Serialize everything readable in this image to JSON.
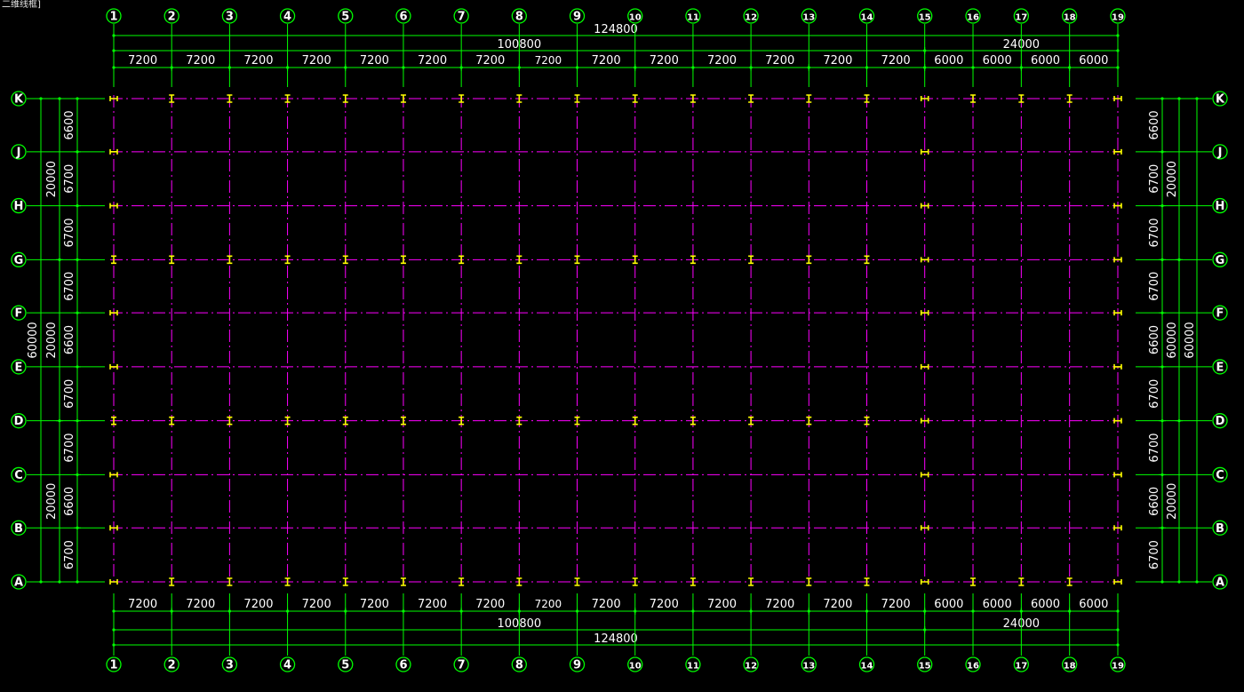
{
  "viewport": {
    "label": "二维线框]"
  },
  "colors": {
    "background": "#000000",
    "dimension": "#00ff00",
    "grid_line": "#ff00ff",
    "column": "#ffff00",
    "bubble": "#00ff00",
    "text": "#ffffff"
  },
  "grid": {
    "columns": [
      "1",
      "2",
      "3",
      "4",
      "5",
      "6",
      "7",
      "8",
      "9",
      "10",
      "11",
      "12",
      "13",
      "14",
      "15",
      "16",
      "17",
      "18",
      "19"
    ],
    "rows": [
      "A",
      "B",
      "C",
      "D",
      "E",
      "F",
      "G",
      "H",
      "J",
      "K"
    ],
    "col_spacing": [
      7200,
      7200,
      7200,
      7200,
      7200,
      7200,
      7200,
      7200,
      7200,
      7200,
      7200,
      7200,
      7200,
      7200,
      6000,
      6000,
      6000,
      6000
    ],
    "row_spacing": [
      6700,
      6600,
      6700,
      6700,
      6700,
      6600,
      6700,
      6700,
      6600,
      6700
    ]
  },
  "dimensions": {
    "top": {
      "overall": "124800",
      "segments": [
        {
          "label": "100800",
          "from": 0,
          "to": 14
        },
        {
          "label": "24000",
          "from": 14,
          "to": 18
        }
      ],
      "spans": [
        "7200",
        "7200",
        "7200",
        "7200",
        "7200",
        "7200",
        "7200",
        "7200",
        "7200",
        "7200",
        "7200",
        "7200",
        "7200",
        "7200",
        "6000",
        "6000",
        "6000",
        "6000"
      ]
    },
    "bottom": {
      "overall": "124800",
      "segments": [
        {
          "label": "100800",
          "from": 0,
          "to": 14
        },
        {
          "label": "24000",
          "from": 14,
          "to": 18
        }
      ],
      "spans": [
        "7200",
        "7200",
        "7200",
        "7200",
        "7200",
        "7200",
        "7200",
        "7200",
        "7200",
        "7200",
        "7200",
        "7200",
        "7200",
        "7200",
        "6000",
        "6000",
        "6000",
        "6000"
      ]
    },
    "left": {
      "overall": "60000",
      "segments": [
        {
          "label": "20000",
          "from": 0,
          "to": 3
        },
        {
          "label": "20000",
          "from": 3,
          "to": 6
        },
        {
          "label": "20000",
          "from": 6,
          "to": 9
        }
      ],
      "spans": [
        "6700",
        "6600",
        "6700",
        "6700",
        "6600",
        "6700",
        "6700",
        "6700",
        "6600",
        "6700"
      ]
    },
    "right": {
      "overall": "60000",
      "segments": [
        {
          "label": "20000",
          "from": 0,
          "to": 3
        },
        {
          "label": "60000",
          "from": 3,
          "to": 6
        },
        {
          "label": "20000",
          "from": 6,
          "to": 9
        }
      ],
      "spans": [
        "6700",
        "6600",
        "6700",
        "6700",
        "6600",
        "6700",
        "6700",
        "6700",
        "6600",
        "6700"
      ]
    }
  },
  "columns_placement": {
    "full_rows": [
      "A",
      "D",
      "G",
      "K"
    ],
    "edge_cols_all_rows": [
      "1",
      "15",
      "19"
    ]
  }
}
